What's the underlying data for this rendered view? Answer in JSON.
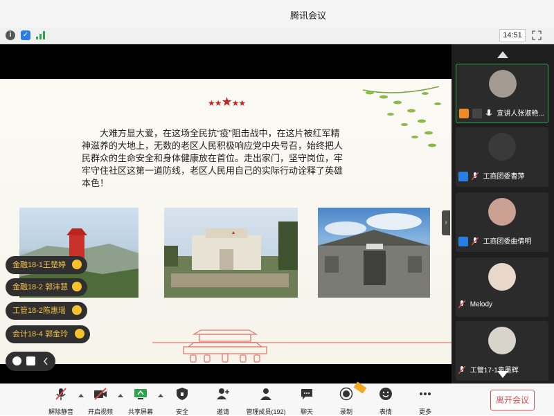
{
  "window": {
    "title": "腾讯会议"
  },
  "infobar": {
    "time": "14:51"
  },
  "slide": {
    "paragraph": "大难方显大爱，在这场全民抗“疫”阻击战中，在这片被红军精神滋养的大地上，无数的老区人民积极响应党中央号召，始终把人民群众的生命安全和身体健康放在首位。走出家门，坚守岗位，牢牢守住社区这第一道防线，老区人民用自己的实际行动诠释了英雄本色！"
  },
  "reactions": [
    {
      "name": "金融18-1王楚婷"
    },
    {
      "name": "金融18-2 郭沣慧"
    },
    {
      "name": "工管18-2陈惠瑶"
    },
    {
      "name": "会计18-4 郭金玲"
    }
  ],
  "participants": [
    {
      "name": "宣讲人张淑艳...",
      "active": true
    },
    {
      "name": "工商团委曹萍"
    },
    {
      "name": "工商团委曲倩明"
    },
    {
      "name": "Melody"
    },
    {
      "name": "工管17-1袁墨辉"
    }
  ],
  "toolbar": {
    "unmute": "解除静音",
    "video": "开启视频",
    "share": "共享屏幕",
    "security": "安全",
    "invite": "邀请",
    "members": "管理成员(192)",
    "chat": "聊天",
    "record": "录制",
    "emoji": "表情",
    "more": "更多",
    "leave": "离开会议"
  },
  "colors": {
    "accent_green": "#2ea44f",
    "leave_red": "#e34d4d",
    "clap_yellow": "#f6c12c",
    "reaction_text": "#f4c24b"
  }
}
